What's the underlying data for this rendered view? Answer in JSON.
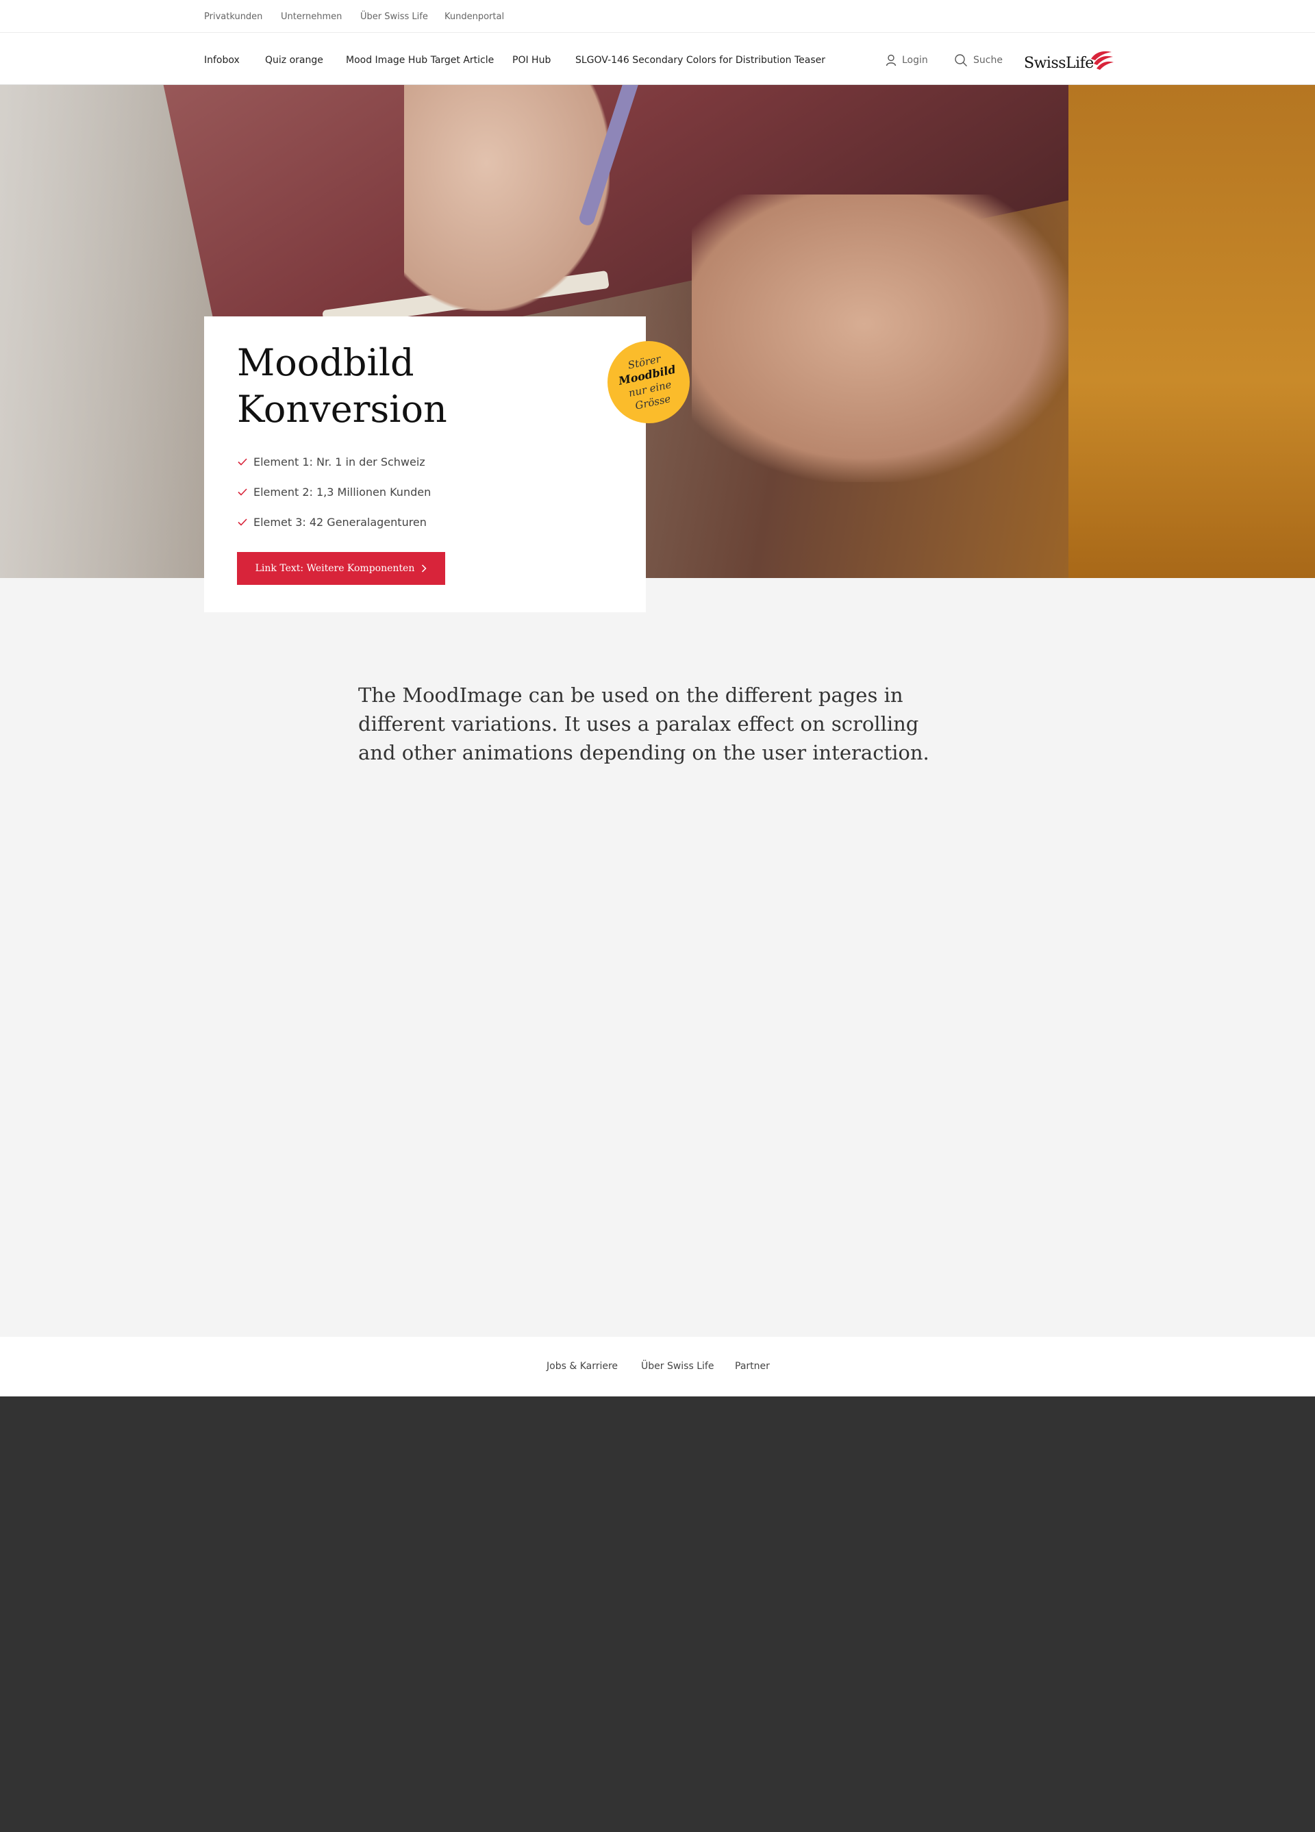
{
  "top_bar": {
    "links": [
      "Privatkunden",
      "Unternehmen",
      "Über Swiss Life",
      "Kundenportal"
    ]
  },
  "main_nav": {
    "links": [
      "Infobox",
      "Quiz orange",
      "Mood Image Hub Target Article",
      "POI Hub",
      "SLGOV-146 Secondary Colors for Distribution Teaser"
    ],
    "login_label": "Login",
    "search_label": "Suche",
    "logo_text": "SwissLife"
  },
  "hero": {
    "title": "Moodbild Konversion",
    "list": [
      "Element 1: Nr. 1 in der Schweiz",
      "Element 2: 1,3 Millionen Kunden",
      "Elemet 3: 42 Generalagenturen"
    ],
    "cta_label": "Link Text: Weitere Komponenten",
    "badge": [
      "Störer",
      "Moodbild",
      "nur eine",
      "Grösse"
    ]
  },
  "intro_text": "The MoodImage can be used on the different pages in different variations. It uses a paralax effect on scrolling and other animations depending on the user interaction.",
  "footer": {
    "links": [
      "Jobs & Karriere",
      "Über Swiss Life",
      "Partner"
    ]
  },
  "colors": {
    "brand_red": "#d8243a",
    "badge_yellow": "#fbbc2b",
    "footer_dark": "#333333",
    "page_bg": "#f4f4f4"
  }
}
